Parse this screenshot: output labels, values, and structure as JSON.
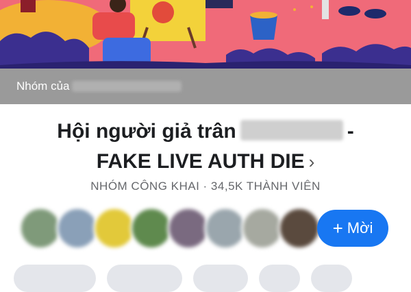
{
  "header": {
    "owner_prefix": "Nhóm của"
  },
  "group": {
    "title_line1": "Hội người giả trân",
    "title_sep": "-",
    "title_line2": "FAKE LIVE AUTH DIE",
    "meta": "NHÓM CÔNG KHAI · 34,5K THÀNH VIÊN"
  },
  "actions": {
    "invite_plus": "+",
    "invite_label": "Mời"
  },
  "colors": {
    "accent": "#1877f2",
    "cover_bg": "#f06a79",
    "owner_bar": "#9a9a9a"
  },
  "icons": [
    "chevron-right-icon",
    "plus-icon"
  ]
}
